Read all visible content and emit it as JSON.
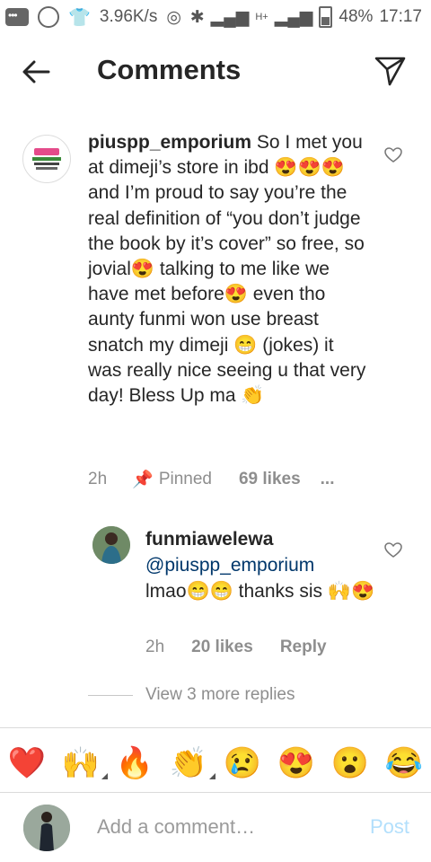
{
  "status_bar": {
    "speed": "3.96K/s",
    "network": "H+",
    "battery": "48%",
    "time": "17:17"
  },
  "header": {
    "title": "Comments",
    "back_icon": "arrow-left-icon",
    "send_icon": "paper-plane-icon"
  },
  "main_comment": {
    "username": "piuspp_emporium",
    "text": "So I met you at dimeji’s store in ibd 😍😍😍 and I’m proud to say you’re the real definition of “you don’t judge the book by it’s cover” so free, so jovial😍 talking to me like we have met before😍 even tho aunty funmi won use breast snatch my dimeji 😁 (jokes) it was really nice seeing u that very day! Bless Up ma 👏",
    "time": "2h",
    "pinned": "Pinned",
    "likes": "69 likes",
    "more": "..."
  },
  "reply": {
    "username": "funmiawelewa",
    "mention": "@piuspp_emporium",
    "text": "lmao😁😁 thanks sis 🙌😍",
    "time": "2h",
    "likes": "20 likes",
    "reply_label": "Reply"
  },
  "view_more": "View 3 more replies",
  "emoji_bar": [
    "❤️",
    "🙌",
    "🔥",
    "👏",
    "😢",
    "😍",
    "😮",
    "😂"
  ],
  "comment_input": {
    "placeholder": "Add a comment…",
    "post_label": "Post"
  },
  "colors": {
    "text": "#262626",
    "meta": "#8e8e8e",
    "mention": "#00376b",
    "post_disabled": "#b2dffc"
  }
}
